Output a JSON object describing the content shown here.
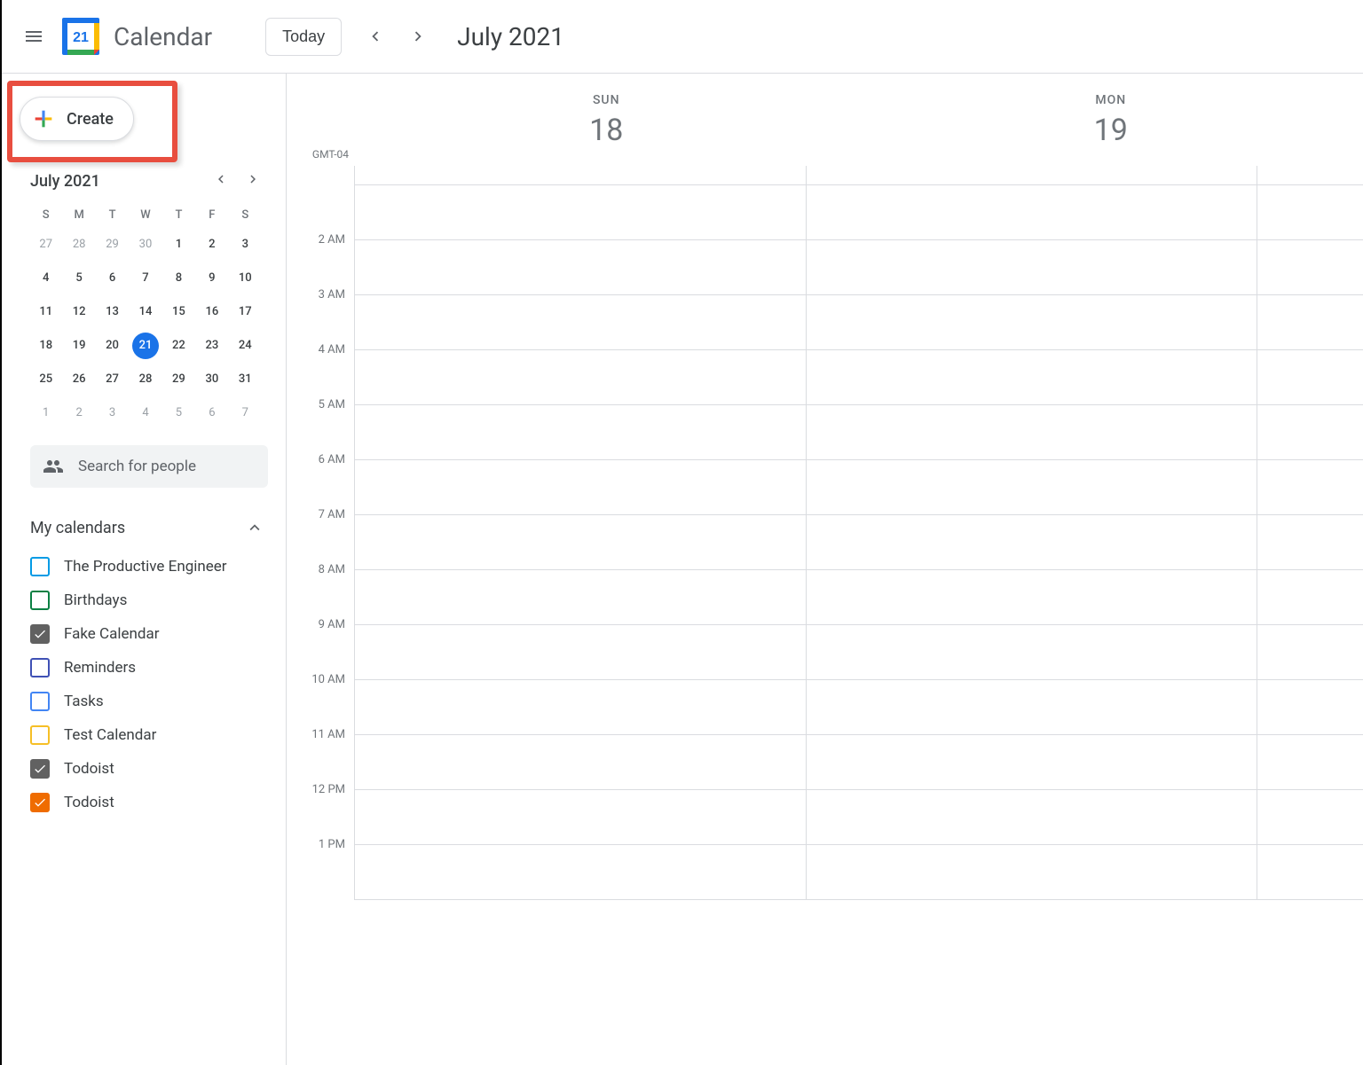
{
  "header": {
    "app_title": "Calendar",
    "today_label": "Today",
    "month_label": "July 2021",
    "logo_date": "21"
  },
  "sidebar": {
    "create_label": "Create",
    "mini_month": "July 2021",
    "dow": [
      "S",
      "M",
      "T",
      "W",
      "T",
      "F",
      "S"
    ],
    "days": [
      {
        "n": "27",
        "other": true
      },
      {
        "n": "28",
        "other": true
      },
      {
        "n": "29",
        "other": true
      },
      {
        "n": "30",
        "other": true
      },
      {
        "n": "1"
      },
      {
        "n": "2"
      },
      {
        "n": "3"
      },
      {
        "n": "4"
      },
      {
        "n": "5"
      },
      {
        "n": "6"
      },
      {
        "n": "7"
      },
      {
        "n": "8"
      },
      {
        "n": "9"
      },
      {
        "n": "10"
      },
      {
        "n": "11"
      },
      {
        "n": "12"
      },
      {
        "n": "13"
      },
      {
        "n": "14"
      },
      {
        "n": "15"
      },
      {
        "n": "16"
      },
      {
        "n": "17"
      },
      {
        "n": "18"
      },
      {
        "n": "19"
      },
      {
        "n": "20"
      },
      {
        "n": "21",
        "today": true
      },
      {
        "n": "22"
      },
      {
        "n": "23"
      },
      {
        "n": "24"
      },
      {
        "n": "25"
      },
      {
        "n": "26"
      },
      {
        "n": "27"
      },
      {
        "n": "28"
      },
      {
        "n": "29"
      },
      {
        "n": "30"
      },
      {
        "n": "31"
      },
      {
        "n": "1",
        "other": true
      },
      {
        "n": "2",
        "other": true
      },
      {
        "n": "3",
        "other": true
      },
      {
        "n": "4",
        "other": true
      },
      {
        "n": "5",
        "other": true
      },
      {
        "n": "6",
        "other": true
      },
      {
        "n": "7",
        "other": true
      }
    ],
    "search_placeholder": "Search for people",
    "my_calendars_label": "My calendars",
    "calendars": [
      {
        "label": "The Productive Engineer",
        "color": "#039be5",
        "checked": false
      },
      {
        "label": "Birthdays",
        "color": "#0b8043",
        "checked": false
      },
      {
        "label": "Fake Calendar",
        "color": "#616161",
        "checked": true
      },
      {
        "label": "Reminders",
        "color": "#3f51b5",
        "checked": false
      },
      {
        "label": "Tasks",
        "color": "#4285f4",
        "checked": false
      },
      {
        "label": "Test Calendar",
        "color": "#f6bf26",
        "checked": false
      },
      {
        "label": "Todoist",
        "color": "#616161",
        "checked": true
      },
      {
        "label": "Todoist",
        "color": "#ef6c00",
        "checked": true
      }
    ]
  },
  "main": {
    "timezone": "GMT-04",
    "days": [
      {
        "dow": "SUN",
        "num": "18"
      },
      {
        "dow": "MON",
        "num": "19"
      }
    ],
    "hours": [
      "",
      "2 AM",
      "3 AM",
      "4 AM",
      "5 AM",
      "6 AM",
      "7 AM",
      "8 AM",
      "9 AM",
      "10 AM",
      "11 AM",
      "12 PM",
      "1 PM"
    ]
  }
}
